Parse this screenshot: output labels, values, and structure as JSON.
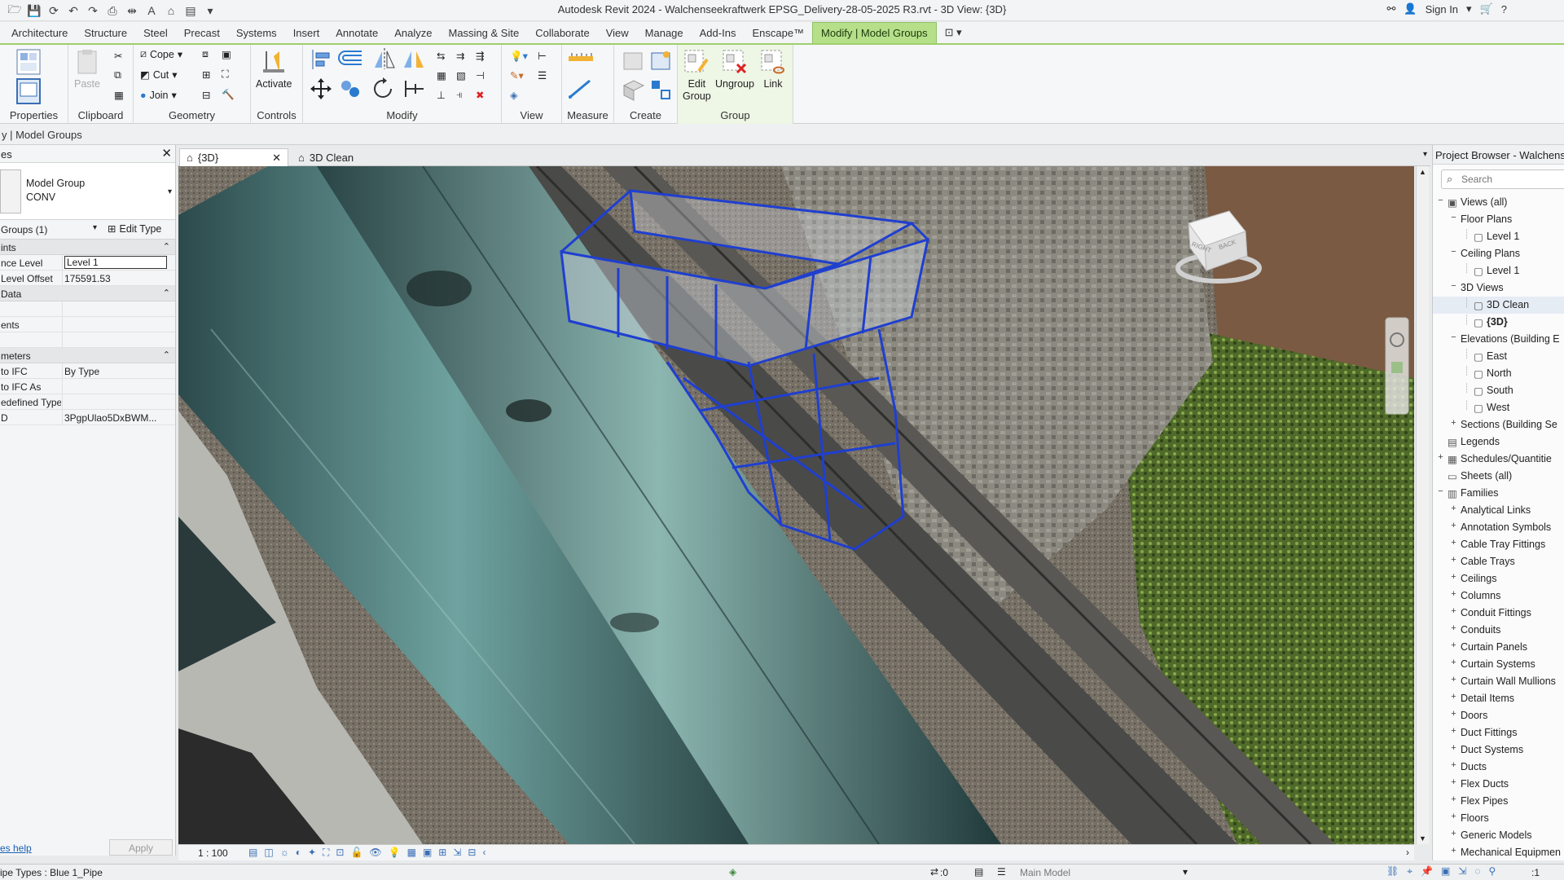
{
  "titlebar": {
    "title": "Autodesk Revit 2024 - Walchenseekraftwerk EPSG_Delivery-28-05-2025 R3.rvt - 3D View: {3D}",
    "sign_in": "Sign In"
  },
  "ribbon_tabs": [
    "Architecture",
    "Structure",
    "Steel",
    "Precast",
    "Systems",
    "Insert",
    "Annotate",
    "Analyze",
    "Massing & Site",
    "Collaborate",
    "View",
    "Manage",
    "Add-Ins",
    "Enscape™",
    "Modify | Model Groups"
  ],
  "ribbon": {
    "properties_label": "Properties",
    "clipboard": {
      "label": "Clipboard",
      "paste": "Paste"
    },
    "geometry": {
      "label": "Geometry",
      "cope": "Cope",
      "cut": "Cut",
      "join": "Join"
    },
    "controls": {
      "label": "Controls",
      "activate": "Activate"
    },
    "modify": {
      "label": "Modify"
    },
    "view": {
      "label": "View"
    },
    "measure": {
      "label": "Measure"
    },
    "create": {
      "label": "Create"
    },
    "group": {
      "label": "Group",
      "edit_group_1": "Edit",
      "edit_group_2": "Group",
      "ungroup": "Ungroup",
      "link": "Link"
    }
  },
  "options_bar": {
    "context": "y | Model Groups"
  },
  "properties": {
    "header": "es",
    "type_name_1": "Model Group",
    "type_name_2": "CONV",
    "instance_filter": "Groups (1)",
    "edit_type": "Edit Type",
    "sections": [
      {
        "title": "ints",
        "rows": [
          {
            "key": "nce Level",
            "value": "Level 1",
            "editable": true
          },
          {
            "key": "Level Offset",
            "value": "175591.53",
            "editable": false
          }
        ]
      },
      {
        "title": "Data",
        "rows": [
          {
            "key": "",
            "value": "",
            "editable": false
          },
          {
            "key": "ents",
            "value": "",
            "editable": false
          },
          {
            "key": "",
            "value": "",
            "editable": false
          }
        ]
      },
      {
        "title": "meters",
        "rows": [
          {
            "key": "to IFC",
            "value": "By Type",
            "editable": false
          },
          {
            "key": "to IFC As",
            "value": "",
            "editable": false
          },
          {
            "key": "edefined Type",
            "value": "",
            "editable": false
          },
          {
            "key": "D",
            "value": "3PgpUlao5DxBWM...",
            "editable": false
          }
        ]
      }
    ],
    "help_link": "es help",
    "apply": "Apply"
  },
  "view_tabs": [
    {
      "label": "{3D}",
      "active": true
    },
    {
      "label": "3D Clean",
      "active": false
    }
  ],
  "viewcube": {
    "right": "RIGHT",
    "back": "BACK"
  },
  "view_control": {
    "scale": "1 : 100"
  },
  "project_browser": {
    "title": "Project Browser - Walchense",
    "search_placeholder": "Search",
    "tree": [
      {
        "label": "Views (all)",
        "level": 0,
        "exp": "−",
        "icon": "views"
      },
      {
        "label": "Floor Plans",
        "level": 1,
        "exp": "−"
      },
      {
        "label": "Level 1",
        "level": 2,
        "exp": "",
        "icon": "view"
      },
      {
        "label": "Ceiling Plans",
        "level": 1,
        "exp": "−"
      },
      {
        "label": "Level 1",
        "level": 2,
        "exp": "",
        "icon": "view"
      },
      {
        "label": "3D Views",
        "level": 1,
        "exp": "−"
      },
      {
        "label": "3D Clean",
        "level": 2,
        "exp": "",
        "icon": "view",
        "sel": true
      },
      {
        "label": "{3D}",
        "level": 2,
        "exp": "",
        "icon": "view",
        "bold": true
      },
      {
        "label": "Elevations (Building E",
        "level": 1,
        "exp": "−"
      },
      {
        "label": "East",
        "level": 2,
        "exp": "",
        "icon": "view"
      },
      {
        "label": "North",
        "level": 2,
        "exp": "",
        "icon": "view"
      },
      {
        "label": "South",
        "level": 2,
        "exp": "",
        "icon": "view"
      },
      {
        "label": "West",
        "level": 2,
        "exp": "",
        "icon": "view"
      },
      {
        "label": "Sections (Building Se",
        "level": 1,
        "exp": "+"
      },
      {
        "label": "Legends",
        "level": 0,
        "exp": "",
        "icon": "legend"
      },
      {
        "label": "Schedules/Quantitie",
        "level": 0,
        "exp": "+",
        "icon": "schedule"
      },
      {
        "label": "Sheets (all)",
        "level": 0,
        "exp": "",
        "icon": "sheet"
      },
      {
        "label": "Families",
        "level": 0,
        "exp": "−",
        "icon": "family"
      },
      {
        "label": "Analytical Links",
        "level": 1,
        "exp": "+"
      },
      {
        "label": "Annotation Symbols",
        "level": 1,
        "exp": "+"
      },
      {
        "label": "Cable Tray Fittings",
        "level": 1,
        "exp": "+"
      },
      {
        "label": "Cable Trays",
        "level": 1,
        "exp": "+"
      },
      {
        "label": "Ceilings",
        "level": 1,
        "exp": "+"
      },
      {
        "label": "Columns",
        "level": 1,
        "exp": "+"
      },
      {
        "label": "Conduit Fittings",
        "level": 1,
        "exp": "+"
      },
      {
        "label": "Conduits",
        "level": 1,
        "exp": "+"
      },
      {
        "label": "Curtain Panels",
        "level": 1,
        "exp": "+"
      },
      {
        "label": "Curtain Systems",
        "level": 1,
        "exp": "+"
      },
      {
        "label": "Curtain Wall Mullions",
        "level": 1,
        "exp": "+"
      },
      {
        "label": "Detail Items",
        "level": 1,
        "exp": "+"
      },
      {
        "label": "Doors",
        "level": 1,
        "exp": "+"
      },
      {
        "label": "Duct Fittings",
        "level": 1,
        "exp": "+"
      },
      {
        "label": "Duct Systems",
        "level": 1,
        "exp": "+"
      },
      {
        "label": "Ducts",
        "level": 1,
        "exp": "+"
      },
      {
        "label": "Flex Ducts",
        "level": 1,
        "exp": "+"
      },
      {
        "label": "Flex Pipes",
        "level": 1,
        "exp": "+"
      },
      {
        "label": "Floors",
        "level": 1,
        "exp": "+"
      },
      {
        "label": "Generic Models",
        "level": 1,
        "exp": "+"
      },
      {
        "label": "Mechanical Equipmen",
        "level": 1,
        "exp": "+"
      }
    ]
  },
  "status_bar": {
    "left": "ipe Types : Blue 1_Pipe",
    "coord": ":0",
    "model": "Main Model",
    "filter_count": ":1"
  },
  "colors": {
    "accent_green": "#b6df8a",
    "selection_blue": "#1f3fd0"
  }
}
